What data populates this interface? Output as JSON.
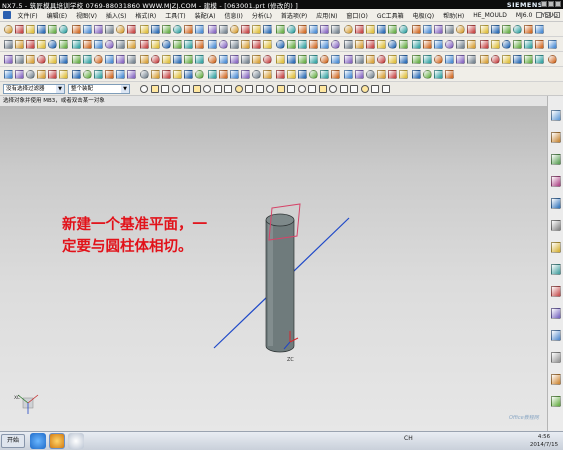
{
  "window": {
    "title": "NX7.5 - 筑匠模具培训学校   0769-88031860   WWW.MJZJ.COM - 建模 - [063001.prt (修改的) ]",
    "brand": "SIEMENS"
  },
  "menu": {
    "items": [
      "文件(F)",
      "编辑(E)",
      "视图(V)",
      "插入(S)",
      "格式(R)",
      "工具(T)",
      "装配(A)",
      "信息(I)",
      "分析(L)",
      "首选项(P)",
      "应用(N)",
      "窗口(O)",
      "GC工具箱",
      "电极(Q)",
      "帮助(H)",
      "HE_MOULD",
      "MJ6.0",
      "YSUG"
    ]
  },
  "selection_bar": {
    "filter_value": "没有选择过滤器",
    "scope_value": "整个装配"
  },
  "cue_line": "选择对象并使用 MB3，或者双击某一对象",
  "annotation": {
    "line1": "新建一个基准平面，一",
    "line2": "定要与圆柱体相切。"
  },
  "triad": {
    "zc": "ZC",
    "xc": "XC"
  },
  "taskbar": {
    "start_label": "开始",
    "tray_text": "CH",
    "time": "4:56",
    "date": "2014/7/15"
  },
  "watermark": "Office教程网",
  "colors": {
    "annotation": "#e2121a",
    "cylinder": "#6f7b7c",
    "datum_plane": "#d54468",
    "axis_line": "#1f49c8"
  }
}
